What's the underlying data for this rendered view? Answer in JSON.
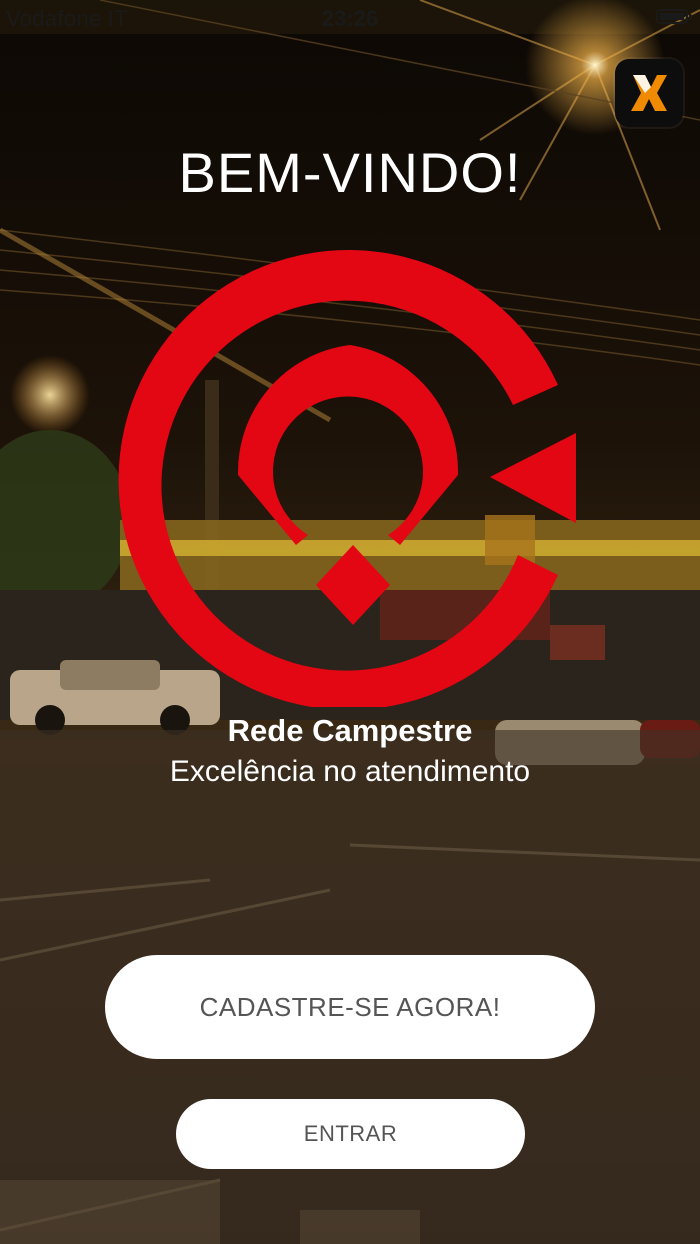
{
  "status_bar": {
    "carrier": "Vodafone IT",
    "time": "23:26"
  },
  "app_badge": {
    "icon": "x-logo-icon",
    "accent": "#F08A00",
    "text": "X"
  },
  "welcome": {
    "title": "BEM-VINDO!"
  },
  "logo": {
    "icon": "rede-campestre-logo-icon",
    "color": "#E30613"
  },
  "brand": {
    "name": "Rede Campestre",
    "tagline": "Excelência no atendimento"
  },
  "actions": {
    "register_label": "CADASTRE-SE AGORA!",
    "login_label": "ENTRAR"
  },
  "colors": {
    "button_bg": "#FFFFFF",
    "button_text": "#555555",
    "brand_red": "#E30613"
  }
}
